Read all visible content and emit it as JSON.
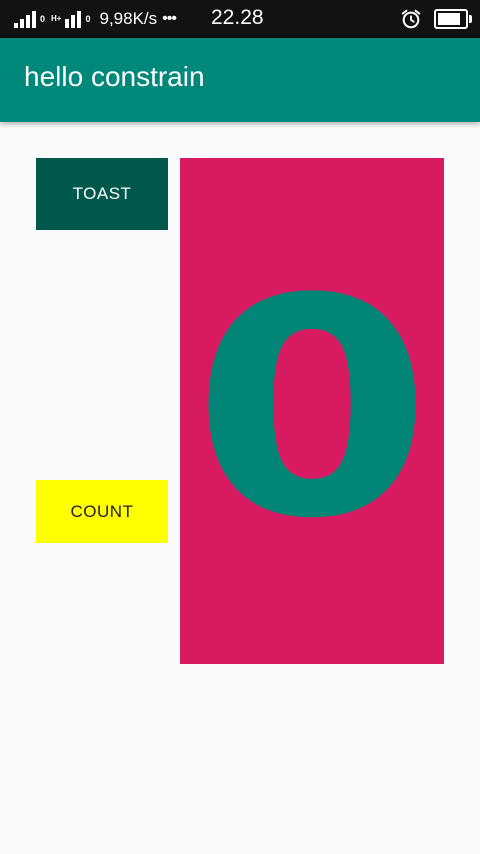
{
  "status_bar": {
    "sim_number": "0",
    "network_type": "H+",
    "sim2_number": "0",
    "net_speed": "9,98K/s",
    "more_dots": "•••",
    "time": "22.28",
    "alarm_icon": "alarm-clock-icon",
    "battery_icon": "battery-icon"
  },
  "app_bar": {
    "title": "hello constrain"
  },
  "buttons": {
    "toast_label": "TOAST",
    "count_label": "COUNT"
  },
  "counter": {
    "value": "0"
  },
  "colors": {
    "primary": "#00897b",
    "primary_dark": "#00574b",
    "accent": "#d81b60",
    "count_button": "#ffff00",
    "count_text": "#008577"
  }
}
